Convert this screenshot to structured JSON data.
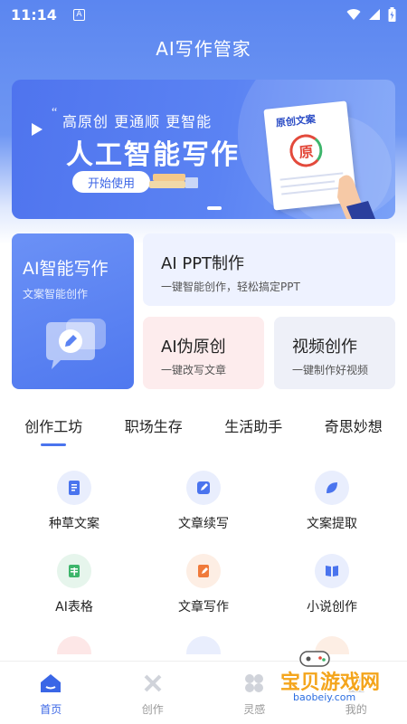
{
  "status_bar": {
    "time": "11:14",
    "notif_letter": "A"
  },
  "header": {
    "title": "AI写作管家"
  },
  "banner": {
    "subtitle": "高原创 更通顺 更智能",
    "title": "人工智能写作",
    "button": "开始使用",
    "doc_label": "原创文案",
    "stamp_char": "原"
  },
  "cards": {
    "ai_write": {
      "title": "AI智能写作",
      "subtitle": "文案智能创作"
    },
    "ppt": {
      "title": "AI PPT制作",
      "subtitle": "一键智能创作，轻松搞定PPT"
    },
    "rewrite": {
      "title": "AI伪原创",
      "subtitle": "一键改写文章"
    },
    "video": {
      "title": "视频创作",
      "subtitle": "一键制作好视频"
    }
  },
  "tabs": [
    "创作工坊",
    "职场生存",
    "生活助手",
    "奇思妙想"
  ],
  "tools": [
    {
      "label": "种草文案",
      "icon": "note-icon",
      "color": "#4a74ee"
    },
    {
      "label": "文章续写",
      "icon": "pen-icon",
      "color": "#4a74ee"
    },
    {
      "label": "文案提取",
      "icon": "leaf-icon",
      "color": "#4a74ee"
    },
    {
      "label": "AI表格",
      "icon": "table-icon",
      "color": "#3db56b"
    },
    {
      "label": "文章写作",
      "icon": "edit-doc-icon",
      "color": "#f07a3a"
    },
    {
      "label": "小说创作",
      "icon": "book-icon",
      "color": "#4a74ee"
    }
  ],
  "bottom_nav": [
    {
      "label": "首页",
      "icon": "home-icon"
    },
    {
      "label": "创作",
      "icon": "tools-icon"
    },
    {
      "label": "灵感",
      "icon": "bulb-icon"
    },
    {
      "label": "我的",
      "icon": "user-icon"
    }
  ],
  "watermark": {
    "title": "宝贝游戏网",
    "url": "baobeiy.com"
  },
  "colors": {
    "primary": "#4a74ee",
    "header_bg": "#5b86f0"
  }
}
